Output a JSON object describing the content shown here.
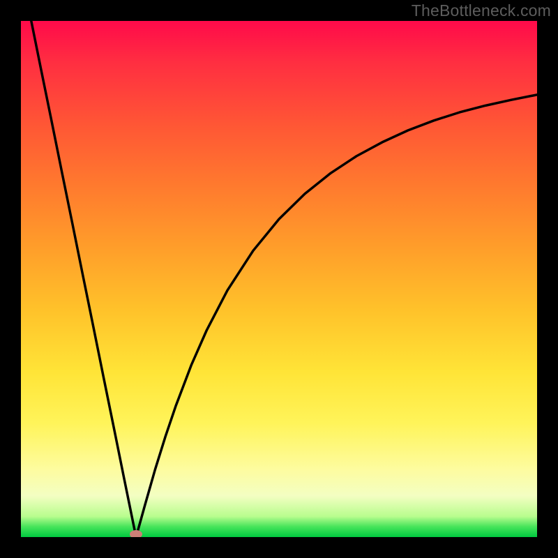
{
  "watermark": "TheBottleneck.com",
  "colors": {
    "background": "#000000",
    "gradient_top": "#ff0a4a",
    "gradient_mid": "#ffe437",
    "gradient_bottom": "#00c940",
    "curve_stroke": "#000000",
    "marker_fill": "#cb7f76",
    "watermark_text": "#5d5d5d"
  },
  "chart_data": {
    "type": "line",
    "title": "",
    "xlabel": "",
    "ylabel": "",
    "xlim": [
      0,
      100
    ],
    "ylim": [
      0,
      100
    ],
    "annotations": [
      {
        "name": "marker-dot",
        "x": 22.3,
        "y": 0.5
      }
    ],
    "series": [
      {
        "name": "bottleneck-curve",
        "x": [
          2.0,
          4.0,
          6.0,
          8.0,
          10.0,
          12.0,
          14.0,
          16.0,
          18.0,
          20.0,
          21.0,
          22.0,
          22.3,
          23.0,
          24.0,
          26.0,
          28.0,
          30.0,
          33.0,
          36.0,
          40.0,
          45.0,
          50.0,
          55.0,
          60.0,
          65.0,
          70.0,
          75.0,
          80.0,
          85.0,
          90.0,
          95.0,
          100.0
        ],
        "values": [
          100.0,
          90.1,
          80.3,
          70.4,
          60.6,
          50.7,
          40.9,
          31.0,
          21.2,
          11.3,
          6.4,
          1.5,
          0.0,
          2.5,
          6.1,
          13.1,
          19.5,
          25.4,
          33.3,
          40.1,
          47.8,
          55.5,
          61.6,
          66.5,
          70.5,
          73.8,
          76.5,
          78.8,
          80.7,
          82.3,
          83.6,
          84.7,
          85.7
        ]
      }
    ]
  }
}
